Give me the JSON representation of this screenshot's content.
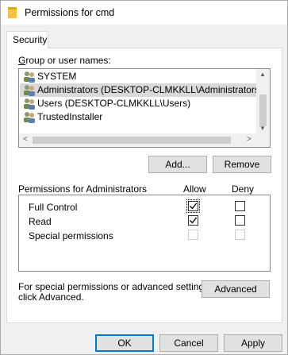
{
  "window": {
    "title": "Permissions for cmd"
  },
  "tabs": [
    {
      "label": "Security"
    }
  ],
  "group_section": {
    "label": "Group or user names:"
  },
  "users": [
    {
      "name": "SYSTEM",
      "selected": false
    },
    {
      "name": "Administrators (DESKTOP-CLMKKLL\\Administrators)",
      "selected": true
    },
    {
      "name": "Users (DESKTOP-CLMKKLL\\Users)",
      "selected": false
    },
    {
      "name": "TrustedInstaller",
      "selected": false
    }
  ],
  "buttons": {
    "add": "Add...",
    "remove": "Remove",
    "advanced": "Advanced",
    "ok": "OK",
    "cancel": "Cancel",
    "apply": "Apply"
  },
  "permissions": {
    "label": "Permissions for Administrators",
    "allow_header": "Allow",
    "deny_header": "Deny",
    "rows": [
      {
        "name": "Full Control",
        "allow": true,
        "deny": false,
        "enabled": true
      },
      {
        "name": "Read",
        "allow": true,
        "deny": false,
        "enabled": true
      },
      {
        "name": "Special permissions",
        "allow": false,
        "deny": false,
        "enabled": false
      }
    ]
  },
  "advanced_note": {
    "line1": "For special permissions or advanced settings,",
    "line2": "click Advanced."
  },
  "colors": {
    "selection": "#d9d9d9",
    "accent": "#0078d7",
    "folder": "#f5c342"
  },
  "icons": {
    "title": "folder-icon",
    "user": "users-group-icon"
  }
}
